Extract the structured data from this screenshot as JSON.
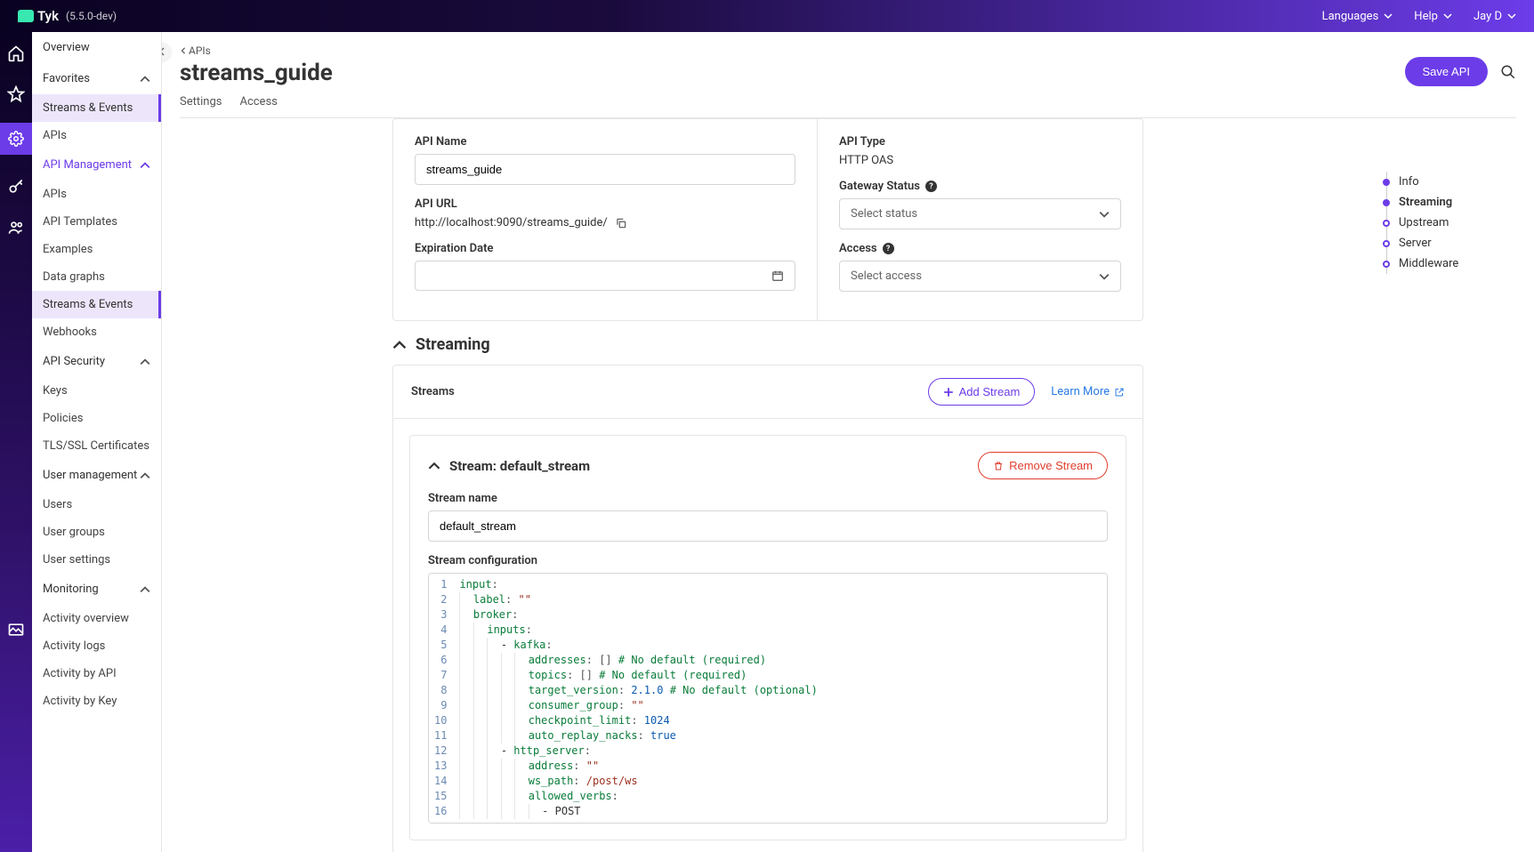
{
  "topbar": {
    "brand": "Tyk",
    "version": "(5.5.0-dev)",
    "languages": "Languages",
    "help": "Help",
    "user": "Jay D"
  },
  "sidebar": {
    "overview": "Overview",
    "favorites": "Favorites",
    "fav_items": [
      "Streams & Events",
      "APIs"
    ],
    "api_management": "API Management",
    "api_mgmt_items": [
      "APIs",
      "API Templates",
      "Examples",
      "Data graphs",
      "Streams & Events",
      "Webhooks"
    ],
    "api_security": "API Security",
    "api_sec_items": [
      "Keys",
      "Policies",
      "TLS/SSL Certificates"
    ],
    "user_management": "User management",
    "user_mgmt_items": [
      "Users",
      "User groups",
      "User settings"
    ],
    "monitoring": "Monitoring",
    "monitoring_items": [
      "Activity overview",
      "Activity logs",
      "Activity by API",
      "Activity by Key"
    ]
  },
  "breadcrumb": {
    "back": "APIs"
  },
  "page": {
    "title": "streams_guide",
    "save": "Save API"
  },
  "tabs": [
    "Settings",
    "Access"
  ],
  "info": {
    "api_name_label": "API Name",
    "api_name_value": "streams_guide",
    "api_url_label": "API URL",
    "api_url_value": "http://localhost:9090/streams_guide/",
    "expiration_label": "Expiration Date",
    "api_type_label": "API Type",
    "api_type_value": "HTTP OAS",
    "gateway_status_label": "Gateway Status",
    "gateway_status_placeholder": "Select status",
    "access_label": "Access",
    "access_placeholder": "Select access"
  },
  "streaming": {
    "section": "Streaming",
    "streams_label": "Streams",
    "add_stream": "Add Stream",
    "learn_more": "Learn More",
    "stream_header_prefix": "Stream: ",
    "stream_id": "default_stream",
    "remove": "Remove Stream",
    "stream_name_label": "Stream name",
    "stream_name_value": "default_stream",
    "config_label": "Stream configuration",
    "code": [
      [
        {
          "t": "key",
          "v": "input"
        },
        {
          "t": "punct",
          "v": ":"
        }
      ],
      [
        {
          "t": "indent",
          "n": 1
        },
        {
          "t": "key",
          "v": "label"
        },
        {
          "t": "punct",
          "v": ": "
        },
        {
          "t": "str",
          "v": "\"\""
        }
      ],
      [
        {
          "t": "indent",
          "n": 1
        },
        {
          "t": "key",
          "v": "broker"
        },
        {
          "t": "punct",
          "v": ":"
        }
      ],
      [
        {
          "t": "indent",
          "n": 2
        },
        {
          "t": "key",
          "v": "inputs"
        },
        {
          "t": "punct",
          "v": ":"
        }
      ],
      [
        {
          "t": "indent",
          "n": 3
        },
        {
          "t": "dash",
          "v": "- "
        },
        {
          "t": "key",
          "v": "kafka"
        },
        {
          "t": "punct",
          "v": ":"
        }
      ],
      [
        {
          "t": "indent",
          "n": 5
        },
        {
          "t": "key",
          "v": "addresses"
        },
        {
          "t": "punct",
          "v": ": "
        },
        {
          "t": "punct",
          "v": "[]"
        },
        {
          "t": "plain",
          "v": " "
        },
        {
          "t": "comment",
          "v": "# No default (required)"
        }
      ],
      [
        {
          "t": "indent",
          "n": 5
        },
        {
          "t": "key",
          "v": "topics"
        },
        {
          "t": "punct",
          "v": ": "
        },
        {
          "t": "punct",
          "v": "[]"
        },
        {
          "t": "plain",
          "v": " "
        },
        {
          "t": "comment",
          "v": "# No default (required)"
        }
      ],
      [
        {
          "t": "indent",
          "n": 5
        },
        {
          "t": "key",
          "v": "target_version"
        },
        {
          "t": "punct",
          "v": ": "
        },
        {
          "t": "num",
          "v": "2.1.0"
        },
        {
          "t": "plain",
          "v": " "
        },
        {
          "t": "comment",
          "v": "# No default (optional)"
        }
      ],
      [
        {
          "t": "indent",
          "n": 5
        },
        {
          "t": "key",
          "v": "consumer_group"
        },
        {
          "t": "punct",
          "v": ": "
        },
        {
          "t": "str",
          "v": "\"\""
        }
      ],
      [
        {
          "t": "indent",
          "n": 5
        },
        {
          "t": "key",
          "v": "checkpoint_limit"
        },
        {
          "t": "punct",
          "v": ": "
        },
        {
          "t": "num",
          "v": "1024"
        }
      ],
      [
        {
          "t": "indent",
          "n": 5
        },
        {
          "t": "key",
          "v": "auto_replay_nacks"
        },
        {
          "t": "punct",
          "v": ": "
        },
        {
          "t": "bool",
          "v": "true"
        }
      ],
      [
        {
          "t": "indent",
          "n": 3
        },
        {
          "t": "dash",
          "v": "- "
        },
        {
          "t": "key",
          "v": "http_server"
        },
        {
          "t": "punct",
          "v": ":"
        }
      ],
      [
        {
          "t": "indent",
          "n": 5
        },
        {
          "t": "key",
          "v": "address"
        },
        {
          "t": "punct",
          "v": ": "
        },
        {
          "t": "str",
          "v": "\"\""
        }
      ],
      [
        {
          "t": "indent",
          "n": 5
        },
        {
          "t": "key",
          "v": "ws_path"
        },
        {
          "t": "punct",
          "v": ": "
        },
        {
          "t": "str",
          "v": "/post/ws"
        }
      ],
      [
        {
          "t": "indent",
          "n": 5
        },
        {
          "t": "key",
          "v": "allowed_verbs"
        },
        {
          "t": "punct",
          "v": ":"
        }
      ],
      [
        {
          "t": "indent",
          "n": 6
        },
        {
          "t": "dash",
          "v": "- "
        },
        {
          "t": "plain",
          "v": "POST"
        }
      ]
    ]
  },
  "sidenav": [
    "Info",
    "Streaming",
    "Upstream",
    "Server",
    "Middleware"
  ]
}
